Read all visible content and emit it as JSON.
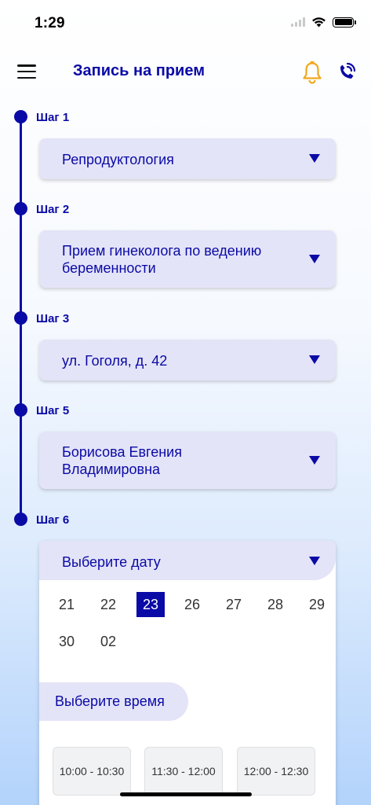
{
  "status_bar": {
    "time": "1:29"
  },
  "header": {
    "title": "Запись на прием",
    "bell_color": "#f2a81d",
    "accent_color": "#0a0aa6"
  },
  "steps": [
    {
      "label": "Шаг 1",
      "value": "Репродуктология"
    },
    {
      "label": "Шаг 2",
      "value_line1": "Прием гинеколога по ведению",
      "value_line2": "беременности"
    },
    {
      "label": "Шаг 3",
      "value": "ул. Гоголя, д. 42"
    },
    {
      "label": "Шаг 5",
      "value_line1": "Борисова Евгения",
      "value_line2": "Владимировна"
    },
    {
      "label": "Шаг 6",
      "value": "Выберите дату"
    }
  ],
  "dates": {
    "days": [
      "21",
      "22",
      "23",
      "26",
      "27",
      "28",
      "29",
      "30",
      "02"
    ],
    "selected": "23"
  },
  "time": {
    "title": "Выберите время",
    "slots": [
      "10:00 - 10:30",
      "11:30 - 12:00",
      "12:00 - 12:30"
    ]
  },
  "icons": [
    "menu-icon",
    "bell-icon",
    "phone-icon",
    "chevron-down-icon",
    "wifi-icon",
    "battery-icon",
    "signal-icon"
  ]
}
